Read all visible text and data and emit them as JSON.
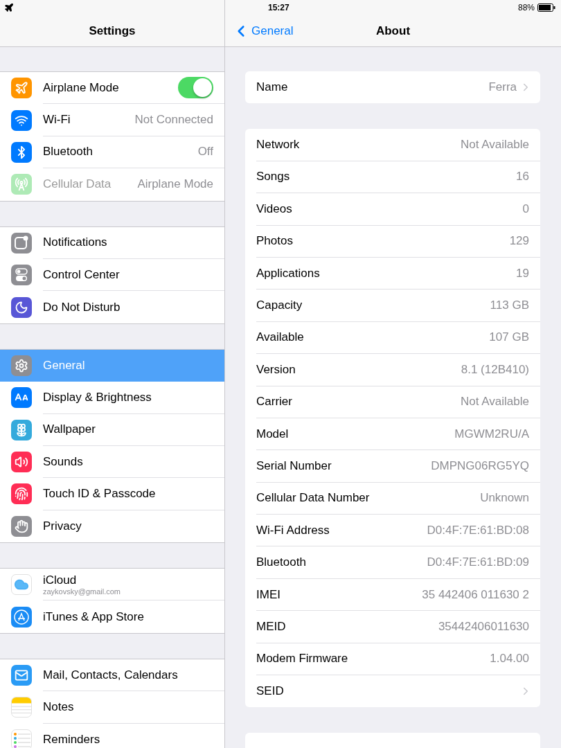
{
  "status_bar": {
    "time": "15:27",
    "battery": "88%"
  },
  "sidebar": {
    "title": "Settings",
    "groups": [
      {
        "items": [
          {
            "label": "Airplane Mode",
            "kind": "toggle",
            "on": true,
            "color": "#ff9500",
            "selected": false,
            "disabled": false
          },
          {
            "label": "Wi-Fi",
            "value": "Not Connected",
            "kind": "value",
            "color": "#007aff",
            "selected": false,
            "disabled": false
          },
          {
            "label": "Bluetooth",
            "value": "Off",
            "kind": "value",
            "color": "#007aff",
            "selected": false,
            "disabled": false
          },
          {
            "label": "Cellular Data",
            "value": "Airplane Mode",
            "kind": "value",
            "color": "#aeeab6",
            "selected": false,
            "disabled": true
          }
        ]
      },
      {
        "items": [
          {
            "label": "Notifications",
            "kind": "plain",
            "color": "#8e8e93",
            "selected": false,
            "disabled": false
          },
          {
            "label": "Control Center",
            "kind": "plain",
            "color": "#8e8e93",
            "selected": false,
            "disabled": false
          },
          {
            "label": "Do Not Disturb",
            "kind": "plain",
            "color": "#5856d6",
            "selected": false,
            "disabled": false
          }
        ]
      },
      {
        "items": [
          {
            "label": "General",
            "kind": "plain",
            "color": "#8e8e93",
            "selected": true,
            "disabled": false
          },
          {
            "label": "Display & Brightness",
            "kind": "plain",
            "color": "#007aff",
            "selected": false,
            "disabled": false
          },
          {
            "label": "Wallpaper",
            "kind": "plain",
            "color": "#34aadc",
            "selected": false,
            "disabled": false
          },
          {
            "label": "Sounds",
            "kind": "plain",
            "color": "#ff2d55",
            "selected": false,
            "disabled": false
          },
          {
            "label": "Touch ID & Passcode",
            "kind": "plain",
            "color": "#ff2d55",
            "selected": false,
            "disabled": false
          },
          {
            "label": "Privacy",
            "kind": "plain",
            "color": "#8e8e93",
            "selected": false,
            "disabled": false
          }
        ]
      },
      {
        "items": [
          {
            "label": "iCloud",
            "subtitle": "zaykovsky@gmail.com",
            "kind": "account",
            "color": "#ffffff",
            "selected": false,
            "disabled": false
          },
          {
            "label": "iTunes & App Store",
            "kind": "plain",
            "color": "#1a8cf5",
            "selected": false,
            "disabled": false
          }
        ]
      },
      {
        "items": [
          {
            "label": "Mail, Contacts, Calendars",
            "kind": "plain",
            "color": "#2a9bf5",
            "selected": false,
            "disabled": false
          },
          {
            "label": "Notes",
            "kind": "plain",
            "color": "#ffffff",
            "selected": false,
            "disabled": false
          },
          {
            "label": "Reminders",
            "kind": "plain",
            "color": "#ffffff",
            "selected": false,
            "disabled": false
          }
        ]
      }
    ]
  },
  "detail": {
    "back": "General",
    "title": "About",
    "groups": [
      {
        "rows": [
          {
            "label": "Name",
            "value": "Ferra",
            "chevron": true
          }
        ]
      },
      {
        "rows": [
          {
            "label": "Network",
            "value": "Not Available",
            "chevron": false
          },
          {
            "label": "Songs",
            "value": "16",
            "chevron": false
          },
          {
            "label": "Videos",
            "value": "0",
            "chevron": false
          },
          {
            "label": "Photos",
            "value": "129",
            "chevron": false
          },
          {
            "label": "Applications",
            "value": "19",
            "chevron": false
          },
          {
            "label": "Capacity",
            "value": "113 GB",
            "chevron": false
          },
          {
            "label": "Available",
            "value": "107 GB",
            "chevron": false
          },
          {
            "label": "Version",
            "value": "8.1 (12B410)",
            "chevron": false
          },
          {
            "label": "Carrier",
            "value": "Not Available",
            "chevron": false
          },
          {
            "label": "Model",
            "value": "MGWM2RU/A",
            "chevron": false
          },
          {
            "label": "Serial Number",
            "value": "DMPNG06RG5YQ",
            "chevron": false
          },
          {
            "label": "Cellular Data Number",
            "value": "Unknown",
            "chevron": false
          },
          {
            "label": "Wi-Fi Address",
            "value": "D0:4F:7E:61:BD:08",
            "chevron": false
          },
          {
            "label": "Bluetooth",
            "value": "D0:4F:7E:61:BD:09",
            "chevron": false
          },
          {
            "label": "IMEI",
            "value": "35 442406 011630 2",
            "chevron": false
          },
          {
            "label": "MEID",
            "value": "35442406011630",
            "chevron": false
          },
          {
            "label": "Modem Firmware",
            "value": "1.04.00",
            "chevron": false
          },
          {
            "label": "SEID",
            "chevron": true
          }
        ]
      }
    ]
  }
}
